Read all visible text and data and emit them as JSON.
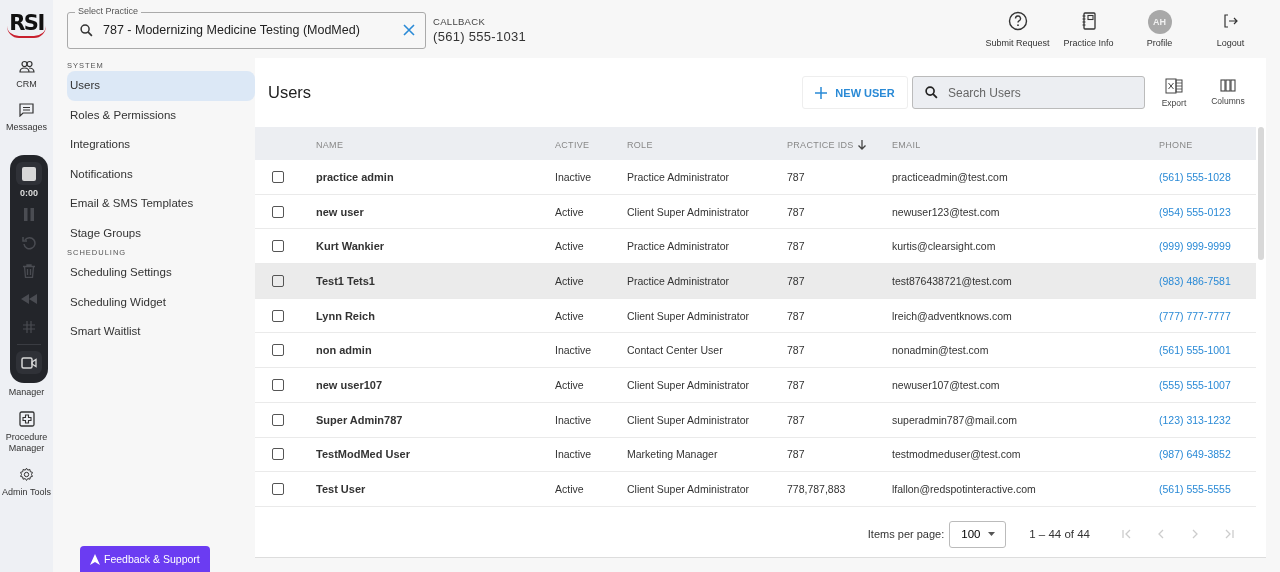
{
  "logo": "RSI",
  "rail": [
    {
      "label": "CRM",
      "kind": "people"
    },
    {
      "label": "Messages",
      "kind": "chat"
    },
    {
      "label": "Manager",
      "kind": "covered"
    },
    {
      "label": "Procedure Manager",
      "kind": "plus-square"
    },
    {
      "label": "Admin Tools",
      "kind": "gear"
    }
  ],
  "recorder": {
    "time": "0:00",
    "controls": [
      {
        "kind": "stop",
        "disabled": false
      },
      {
        "kind": "pause",
        "disabled": true
      },
      {
        "kind": "restart",
        "disabled": true
      },
      {
        "kind": "trash",
        "disabled": true
      },
      {
        "kind": "rewind",
        "disabled": true
      },
      {
        "kind": "grid",
        "disabled": true
      },
      {
        "kind": "camera",
        "disabled": false
      }
    ]
  },
  "practice_select": {
    "label": "Select Practice",
    "value": "787 - Modernizing Medicine Testing (ModMed)"
  },
  "callback": {
    "label": "CALLBACK",
    "phone": "(561) 555-1031"
  },
  "header_actions": [
    {
      "label": "Submit Request",
      "kind": "help"
    },
    {
      "label": "Practice Info",
      "kind": "notebook"
    },
    {
      "label": "Profile",
      "kind": "avatar",
      "initials": "AH"
    },
    {
      "label": "Logout",
      "kind": "logout"
    }
  ],
  "sidebar": [
    {
      "title": "SYSTEM",
      "items": [
        {
          "label": "Users",
          "selected": true
        },
        {
          "label": "Roles & Permissions",
          "selected": false
        },
        {
          "label": "Integrations",
          "selected": false
        },
        {
          "label": "Notifications",
          "selected": false
        },
        {
          "label": "Email & SMS Templates",
          "selected": false
        },
        {
          "label": "Stage Groups",
          "selected": false
        }
      ]
    },
    {
      "title": "SCHEDULING",
      "items": [
        {
          "label": "Scheduling Settings",
          "selected": false
        },
        {
          "label": "Scheduling Widget",
          "selected": false
        },
        {
          "label": "Smart Waitlist",
          "selected": false
        }
      ]
    }
  ],
  "page": {
    "title": "Users",
    "new_button": "NEW USER",
    "search": {
      "placeholder": "Search Users"
    },
    "tools": [
      {
        "label": "Export",
        "kind": "excel"
      },
      {
        "label": "Columns",
        "kind": "columns"
      }
    ]
  },
  "table": {
    "columns": [
      {
        "label": "NAME",
        "sorted": false
      },
      {
        "label": "ACTIVE",
        "sorted": false
      },
      {
        "label": "ROLE",
        "sorted": false
      },
      {
        "label": "PRACTICE IDS",
        "sorted": true
      },
      {
        "label": "EMAIL",
        "sorted": false
      },
      {
        "label": "PHONE",
        "sorted": false
      }
    ],
    "rows": [
      {
        "checked": false,
        "hovered": false,
        "cells": [
          "practice admin",
          "Inactive",
          "Practice Administrator",
          "787",
          "practiceadmin@test.com",
          "(561) 555-1028"
        ]
      },
      {
        "checked": false,
        "hovered": false,
        "cells": [
          "new user",
          "Active",
          "Client Super Administrator",
          "787",
          "newuser123@test.com",
          "(954) 555-0123"
        ]
      },
      {
        "checked": false,
        "hovered": false,
        "cells": [
          "Kurt Wankier",
          "Active",
          "Practice Administrator",
          "787",
          "kurtis@clearsight.com",
          "(999) 999-9999"
        ]
      },
      {
        "checked": false,
        "hovered": true,
        "cells": [
          "Test1 Tets1",
          "Active",
          "Practice Administrator",
          "787",
          "test876438721@test.com",
          "(983) 486-7581"
        ]
      },
      {
        "checked": false,
        "hovered": false,
        "cells": [
          "Lynn Reich",
          "Active",
          "Client Super Administrator",
          "787",
          "lreich@adventknows.com",
          "(777) 777-7777"
        ]
      },
      {
        "checked": false,
        "hovered": false,
        "cells": [
          "non admin",
          "Inactive",
          "Contact Center User",
          "787",
          "nonadmin@test.com",
          "(561) 555-1001"
        ]
      },
      {
        "checked": false,
        "hovered": false,
        "cells": [
          "new user107",
          "Active",
          "Client Super Administrator",
          "787",
          "newuser107@test.com",
          "(555) 555-1007"
        ]
      },
      {
        "checked": false,
        "hovered": false,
        "cells": [
          "Super Admin787",
          "Inactive",
          "Client Super Administrator",
          "787",
          "superadmin787@mail.com",
          "(123) 313-1232"
        ]
      },
      {
        "checked": false,
        "hovered": false,
        "cells": [
          "TestModMed User",
          "Inactive",
          "Marketing Manager",
          "787",
          "testmodmeduser@test.com",
          "(987) 649-3852"
        ]
      },
      {
        "checked": false,
        "hovered": false,
        "cells": [
          "Test User",
          "Active",
          "Client Super Administrator",
          "778,787,883",
          "lfallon@redspotinteractive.com",
          "(561) 555-5555"
        ]
      }
    ]
  },
  "pagination": {
    "label": "Items per page:",
    "page_size": "100",
    "range": "1 – 44 of 44",
    "nav": [
      {
        "kind": "first",
        "disabled": true
      },
      {
        "kind": "prev",
        "disabled": true
      },
      {
        "kind": "next",
        "disabled": true
      },
      {
        "kind": "last",
        "disabled": true
      }
    ]
  },
  "feedback_button": "Feedback & Support"
}
